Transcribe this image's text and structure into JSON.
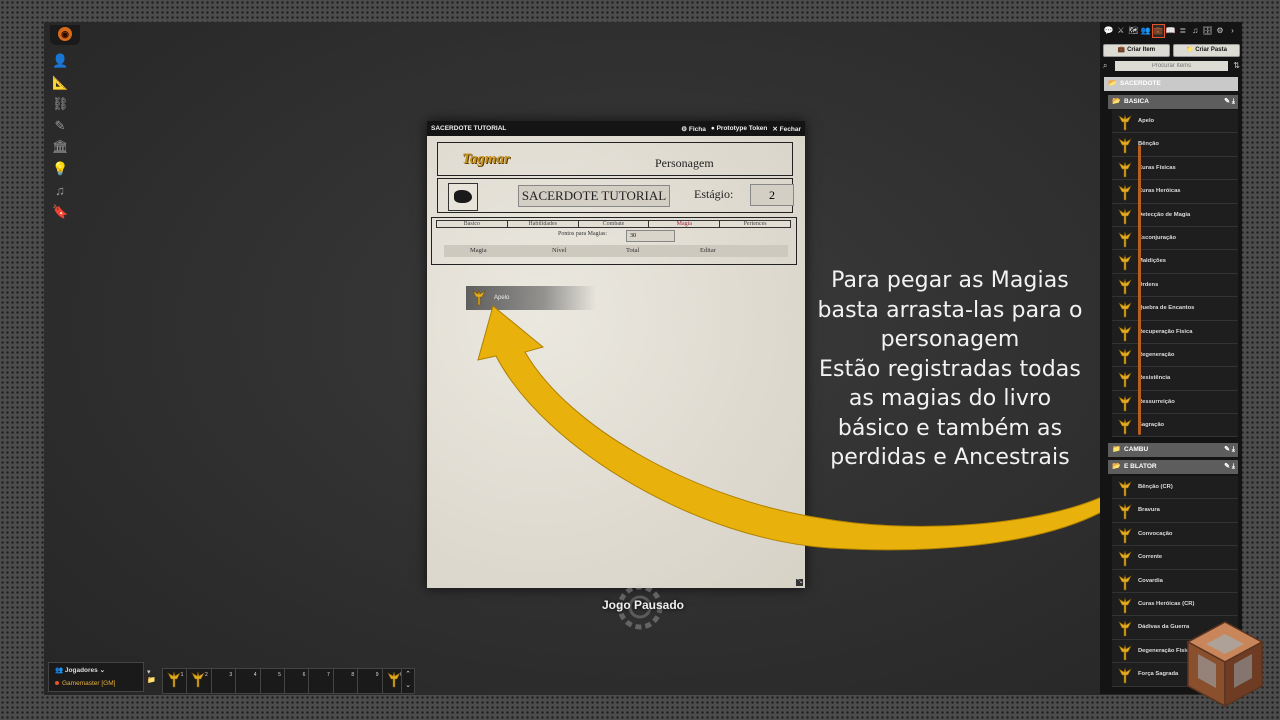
{
  "scene_controls": {
    "logo_icon": "d20-logo-icon",
    "items": [
      {
        "name": "token-controls-icon",
        "glyph": "👤"
      },
      {
        "name": "measure-controls-icon",
        "glyph": "📐"
      },
      {
        "name": "tile-controls-icon",
        "glyph": "⛓"
      },
      {
        "name": "drawing-controls-icon",
        "glyph": "✎"
      },
      {
        "name": "wall-controls-icon",
        "glyph": "🏛"
      },
      {
        "name": "lighting-controls-icon",
        "glyph": "💡"
      },
      {
        "name": "sound-controls-icon",
        "glyph": "♫"
      },
      {
        "name": "notes-controls-icon",
        "glyph": "🔖"
      }
    ]
  },
  "sheet": {
    "title": "SACERDOTE TUTORIAL",
    "header_buttons": {
      "ficha": "Ficha",
      "prototype": "Prototype Token",
      "close": "Fechar"
    },
    "game_logo": "Tagmar",
    "section_title": "Personagem",
    "character_name": "SACERDOTE TUTORIAL",
    "stage_label": "Estágio:",
    "stage_value": "2",
    "tabs": [
      "Básico",
      "Habilidades",
      "Combate",
      "Magia",
      "Pertences"
    ],
    "active_tab": "Magia",
    "points_label": "Pontos para Magias:",
    "points_value": "30",
    "columns": [
      "Magia",
      "Nível",
      "Total",
      "Editar"
    ],
    "dragged_item": "Apelo"
  },
  "paused_text": "Jogo Pausado",
  "annotation": {
    "lines": [
      "Para pegar as Magias",
      "basta arrasta-las para o",
      "personagem",
      "Estão registradas todas",
      "as magias do livro",
      "básico e também as",
      "perdidas e Ancestrais"
    ],
    "arrow_color": "#e8b10c"
  },
  "sidebar": {
    "tabs": [
      {
        "name": "chat-tab-icon",
        "glyph": "💬"
      },
      {
        "name": "combat-tab-icon",
        "glyph": "⚔"
      },
      {
        "name": "scenes-tab-icon",
        "glyph": "🗺"
      },
      {
        "name": "actors-tab-icon",
        "glyph": "👥"
      },
      {
        "name": "items-tab-icon",
        "glyph": "💼",
        "active": true
      },
      {
        "name": "journal-tab-icon",
        "glyph": "📖"
      },
      {
        "name": "tables-tab-icon",
        "glyph": "≣"
      },
      {
        "name": "playlists-tab-icon",
        "glyph": "♫"
      },
      {
        "name": "compendium-tab-icon",
        "glyph": "🗄"
      },
      {
        "name": "settings-tab-icon",
        "glyph": "⚙"
      },
      {
        "name": "collapse-tab-icon",
        "glyph": "›"
      }
    ],
    "create_item": "Criar Item",
    "create_folder": "Criar Pasta",
    "search_placeholder": "Procurar Items",
    "folder_main": "SACERDOTE",
    "folder_basica": "BASICA",
    "folder_second": "CAMBU",
    "folder_third": "E BLATOR",
    "basica_items": [
      "Apelo",
      "Bênção",
      "Curas Físicas",
      "Curas Heróicas",
      "Detecção de Magia",
      "Esconjuração",
      "Maldições",
      "Ordens",
      "Quebra de Encantos",
      "Recuperação Física",
      "Regeneração",
      "Resistência",
      "Ressurreição",
      "Sagração"
    ],
    "blator_items": [
      "Bênção (CR)",
      "Bravura",
      "Convocação",
      "Corrente",
      "Covardia",
      "Curas Heróicas (CR)",
      "Dádivas da Guerra",
      "Degeneração Física",
      "Força Sagrada"
    ],
    "accent_color": "#e4552b"
  },
  "players": {
    "title": "Jogadores",
    "gm": "Gamemaster [GM]"
  },
  "hotbar": {
    "slots": [
      "1",
      "2",
      "3",
      "4",
      "5",
      "6",
      "7",
      "8",
      "9",
      "0"
    ],
    "filled": [
      true,
      true,
      false,
      false,
      false,
      false,
      false,
      false,
      false,
      true
    ]
  }
}
